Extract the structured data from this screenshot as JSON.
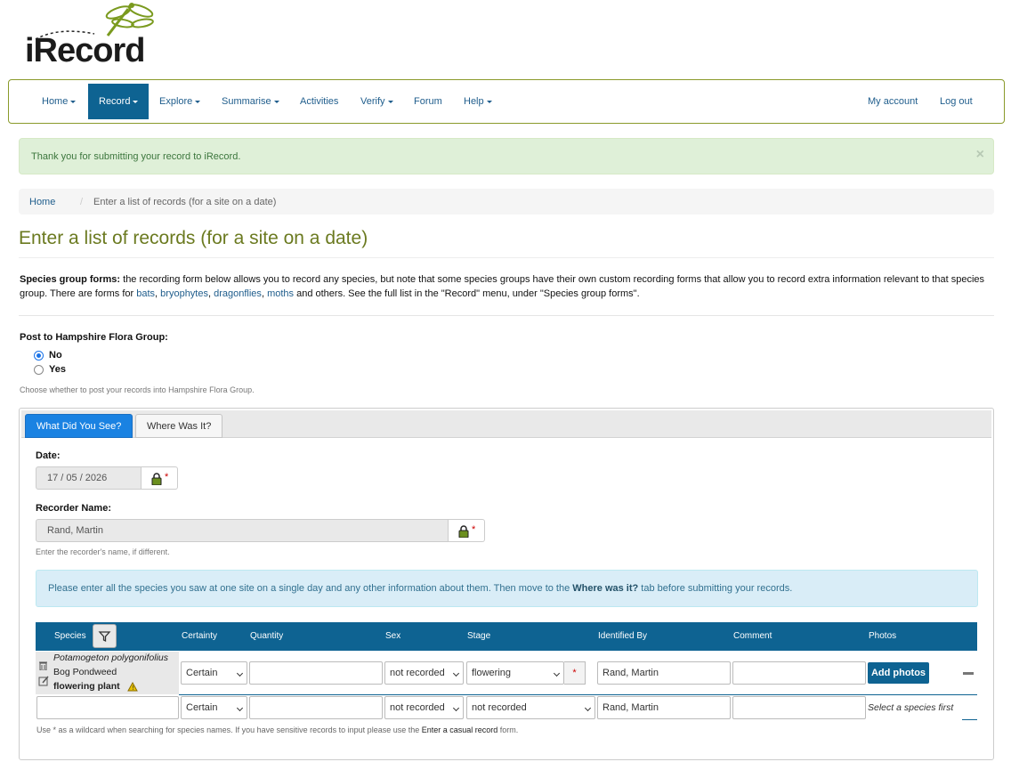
{
  "logo": {
    "text": "iRecord"
  },
  "nav": {
    "home": "Home",
    "record": "Record",
    "explore": "Explore",
    "summarise": "Summarise",
    "activities": "Activities",
    "verify": "Verify",
    "forum": "Forum",
    "help": "Help",
    "my_account": "My account",
    "log_out": "Log out"
  },
  "alert": {
    "message": "Thank you for submitting your record to iRecord.",
    "close": "×"
  },
  "breadcrumb": {
    "home": "Home",
    "separator": "/",
    "current": "Enter a list of records (for a site on a date)"
  },
  "page_title": "Enter a list of records (for a site on a date)",
  "intro": {
    "bold": "Species group forms:",
    "text1": " the recording form below allows you to record any species, but note that some species groups have their own custom recording forms that allow you to record extra information relevant to that species group. There are forms for ",
    "link_bats": "bats",
    "comma1": ", ",
    "link_bryophytes": "bryophytes",
    "comma2": ", ",
    "link_dragonflies": "dragonflies",
    "comma3": ", ",
    "link_moths": "moths",
    "text2": " and others. See the full list in the \"Record\" menu, under \"Species group forms\"."
  },
  "post_group": {
    "label": "Post to Hampshire Flora Group:",
    "option_no": "No",
    "option_yes": "Yes",
    "selected": "No",
    "help": "Choose whether to post your records into Hampshire Flora Group."
  },
  "tabs": {
    "what": "What Did You See?",
    "where": "Where Was It?"
  },
  "date": {
    "label": "Date:",
    "value": "17 / 05 / 2026",
    "required": "*"
  },
  "recorder": {
    "label": "Recorder Name:",
    "value": "Rand, Martin",
    "required": "*",
    "help": "Enter the recorder's name, if different."
  },
  "info": {
    "text1": "Please enter all the species you saw at one site on a single day and any other information about them. Then move to the ",
    "bold": "Where was it?",
    "text2": " tab before submitting your records."
  },
  "grid": {
    "headers": {
      "species": "Species",
      "certainty": "Certainty",
      "quantity": "Quantity",
      "sex": "Sex",
      "stage": "Stage",
      "identified_by": "Identified By",
      "comment": "Comment",
      "photos": "Photos"
    },
    "row1": {
      "scientific": "Potamogeton polygonifolius",
      "common": "Bog Pondweed",
      "group": "flowering plant",
      "certainty": "Certain",
      "quantity": "",
      "sex": "not recorded",
      "stage": "flowering",
      "stage_required": "*",
      "identified_by": "Rand, Martin",
      "comment": "",
      "photos_button": "Add photos"
    },
    "row2": {
      "species": "",
      "certainty": "Certain",
      "quantity": "",
      "sex": "not recorded",
      "stage": "not recorded",
      "identified_by": "Rand, Martin",
      "comment": "",
      "photos_hint": "Select a species first"
    },
    "footer": {
      "text1": "Use * as a wildcard when searching for species names. If you have sensitive records to input please use the ",
      "link": "Enter a casual record",
      "text2": " form."
    }
  },
  "colors": {
    "brand_blue": "#0e6392",
    "title_olive": "#6b7a20",
    "alert_green_bg": "#dff0d8",
    "info_blue_bg": "#d9edf7"
  }
}
